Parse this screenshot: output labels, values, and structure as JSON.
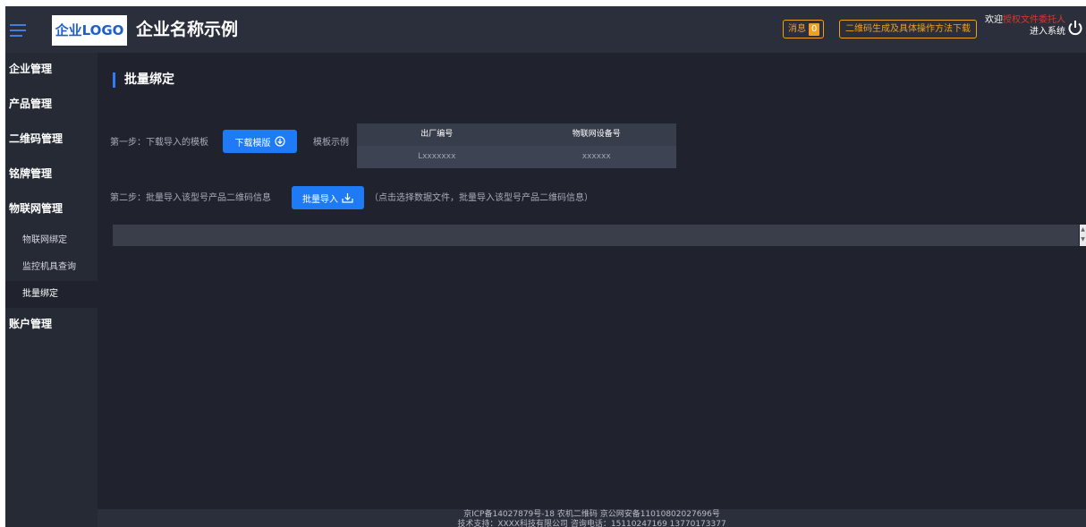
{
  "header": {
    "logo": "企业LOGO",
    "company_name": "企业名称示例",
    "messages_label": "消息",
    "messages_count": "0",
    "qr_download_label": "二维码生成及具体操作方法下载",
    "welcome_prefix": "欢迎",
    "welcome_user": "授权文件委托人",
    "enter_system": "进入系统"
  },
  "sidebar": {
    "items": [
      {
        "label": "企业管理"
      },
      {
        "label": "产品管理"
      },
      {
        "label": "二维码管理"
      },
      {
        "label": "铭牌管理"
      },
      {
        "label": "物联网管理",
        "children": [
          {
            "label": "物联网绑定"
          },
          {
            "label": "监控机具查询"
          },
          {
            "label": "批量绑定",
            "active": true
          }
        ]
      },
      {
        "label": "账户管理"
      }
    ]
  },
  "main": {
    "title": "批量绑定",
    "step1_text": "第一步：下载导入的模板",
    "download_button": "下载模版",
    "template_example_label": "模板示例",
    "example_table": {
      "columns": [
        "出厂编号",
        "物联网设备号"
      ],
      "rows": [
        [
          "Lxxxxxxx",
          "xxxxxx"
        ]
      ]
    },
    "step2_text": "第二步：批量导入该型号产品二维码信息",
    "import_button": "批量导入",
    "import_hint": "（点击选择数据文件，批量导入该型号产品二维码信息）"
  },
  "footer": {
    "line1": "京ICP备14027879号-18 农机二维码 京公网安备11010802027696号",
    "line2": "技术支持：XXXX科技有限公司 咨询电话：15110247169 13770173377"
  },
  "colors": {
    "background": "#20232e",
    "header": "#2b2f3b",
    "accent": "#1f7af5",
    "warning": "#f0a020",
    "highlight": "#e0342a"
  },
  "icons": {
    "menu": "hamburger-menu-icon",
    "power": "power-icon",
    "download": "circle-down-arrow-icon",
    "import": "tray-download-icon"
  }
}
